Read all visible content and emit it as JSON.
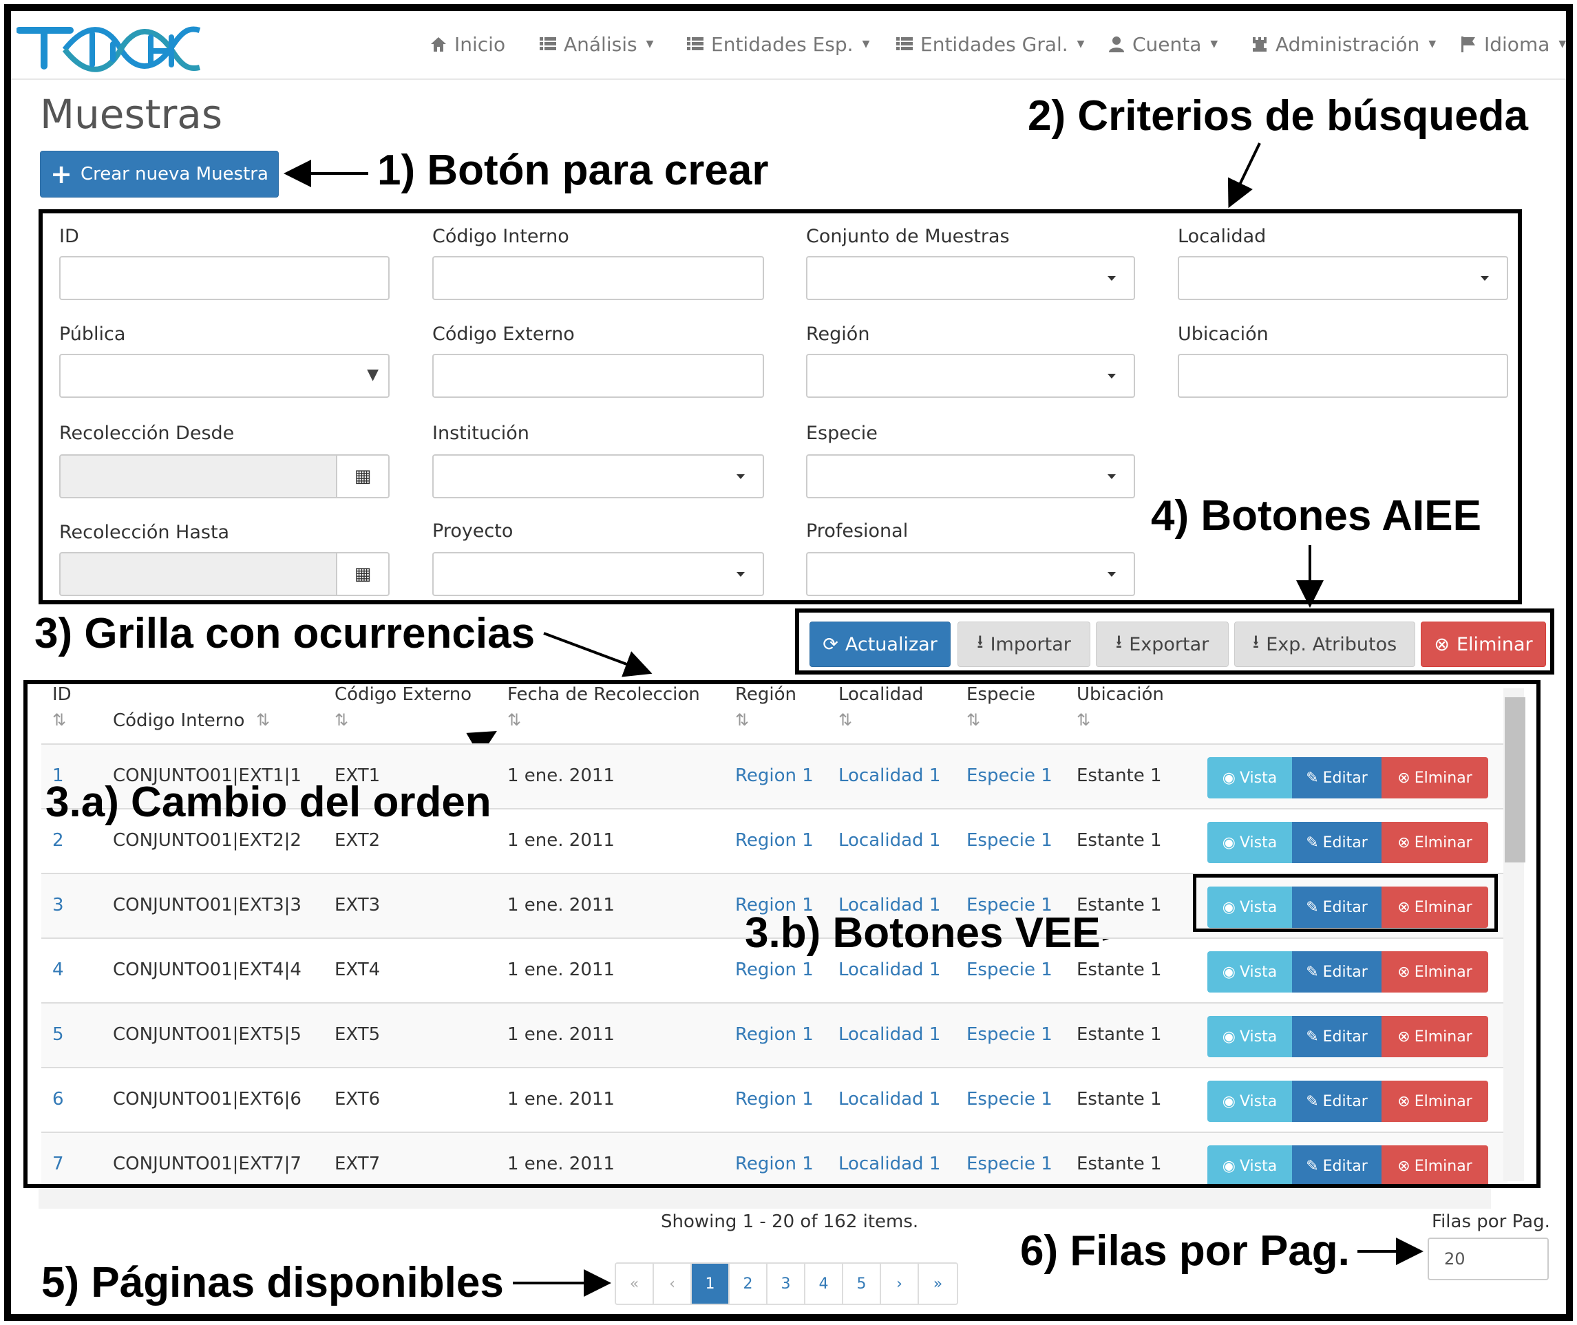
{
  "navbar": {
    "logo_text": "T-GA",
    "items": [
      {
        "label": "Inicio",
        "icon": "home-icon"
      },
      {
        "label": "Análisis",
        "icon": "list-icon"
      },
      {
        "label": "Entidades Esp.",
        "icon": "list-icon"
      },
      {
        "label": "Entidades Gral.",
        "icon": "list-icon"
      },
      {
        "label": "Cuenta",
        "icon": "user-icon"
      },
      {
        "label": "Administración",
        "icon": "tower-icon"
      },
      {
        "label": "Idioma",
        "icon": "flag-icon"
      }
    ]
  },
  "page": {
    "title": "Muestras",
    "create_button": "Crear nueva Muestra"
  },
  "filters": {
    "id": {
      "label": "ID",
      "value": ""
    },
    "codigo_interno": {
      "label": "Código Interno",
      "value": ""
    },
    "conjunto": {
      "label": "Conjunto de Muestras",
      "value": ""
    },
    "localidad": {
      "label": "Localidad",
      "value": ""
    },
    "publica": {
      "label": "Pública",
      "value": ""
    },
    "codigo_externo": {
      "label": "Código Externo",
      "value": ""
    },
    "region": {
      "label": "Región",
      "value": ""
    },
    "ubicacion": {
      "label": "Ubicación",
      "value": ""
    },
    "recoleccion_desde": {
      "label": "Recolección Desde",
      "value": ""
    },
    "institucion": {
      "label": "Institución",
      "value": ""
    },
    "especie": {
      "label": "Especie",
      "value": ""
    },
    "recoleccion_hasta": {
      "label": "Recolección Hasta",
      "value": ""
    },
    "proyecto": {
      "label": "Proyecto",
      "value": ""
    },
    "profesional": {
      "label": "Profesional",
      "value": ""
    }
  },
  "toolbar": {
    "actualizar": "Actualizar",
    "importar": "Importar",
    "exportar": "Exportar",
    "exp_atributos": "Exp. Atributos",
    "eliminar": "Eliminar"
  },
  "grid": {
    "columns": [
      "ID",
      "Código Interno",
      "Código Externo",
      "Fecha de Recoleccion",
      "Región",
      "Localidad",
      "Especie",
      "Ubicación"
    ],
    "action_labels": {
      "view": "Vista",
      "edit": "Editar",
      "delete": "Elminar"
    },
    "rows": [
      {
        "id": "1",
        "interno": "CONJUNTO01|EXT1|1",
        "externo": "EXT1",
        "fecha": "1 ene. 2011",
        "region": "Region 1",
        "localidad": "Localidad 1",
        "especie": "Especie 1",
        "ubicacion": "Estante 1"
      },
      {
        "id": "2",
        "interno": "CONJUNTO01|EXT2|2",
        "externo": "EXT2",
        "fecha": "1 ene. 2011",
        "region": "Region 1",
        "localidad": "Localidad 1",
        "especie": "Especie 1",
        "ubicacion": "Estante 1"
      },
      {
        "id": "3",
        "interno": "CONJUNTO01|EXT3|3",
        "externo": "EXT3",
        "fecha": "1 ene. 2011",
        "region": "Region 1",
        "localidad": "Localidad 1",
        "especie": "Especie 1",
        "ubicacion": "Estante 1"
      },
      {
        "id": "4",
        "interno": "CONJUNTO01|EXT4|4",
        "externo": "EXT4",
        "fecha": "1 ene. 2011",
        "region": "Region 1",
        "localidad": "Localidad 1",
        "especie": "Especie 1",
        "ubicacion": "Estante 1"
      },
      {
        "id": "5",
        "interno": "CONJUNTO01|EXT5|5",
        "externo": "EXT5",
        "fecha": "1 ene. 2011",
        "region": "Region 1",
        "localidad": "Localidad 1",
        "especie": "Especie 1",
        "ubicacion": "Estante 1"
      },
      {
        "id": "6",
        "interno": "CONJUNTO01|EXT6|6",
        "externo": "EXT6",
        "fecha": "1 ene. 2011",
        "region": "Region 1",
        "localidad": "Localidad 1",
        "especie": "Especie 1",
        "ubicacion": "Estante 1"
      },
      {
        "id": "7",
        "interno": "CONJUNTO01|EXT7|7",
        "externo": "EXT7",
        "fecha": "1 ene. 2011",
        "region": "Region 1",
        "localidad": "Localidad 1",
        "especie": "Especie 1",
        "ubicacion": "Estante 1"
      }
    ]
  },
  "footer": {
    "status": "Showing 1 - 20 of 162 items.",
    "pages": [
      "«",
      "‹",
      "1",
      "2",
      "3",
      "4",
      "5",
      "›",
      "»"
    ],
    "active_page": "1",
    "rows_per_page_label": "Filas por Pag.",
    "rows_per_page_value": "20"
  },
  "annotations": {
    "a1": "1) Botón para crear",
    "a2": "2) Criterios de búsqueda",
    "a3": "3) Grilla con ocurrencias",
    "a3a": "3.a) Cambio del orden",
    "a3b": "3.b) Botones VEE",
    "a4": "4) Botones AIEE",
    "a5": "5) Páginas disponibles",
    "a6": "6) Filas por Pag."
  },
  "colors": {
    "primary": "#337ab7",
    "info": "#5bc0de",
    "danger": "#d9534f",
    "logo_blue": "#1d8fd0",
    "logo_teal": "#2a9ab6"
  }
}
